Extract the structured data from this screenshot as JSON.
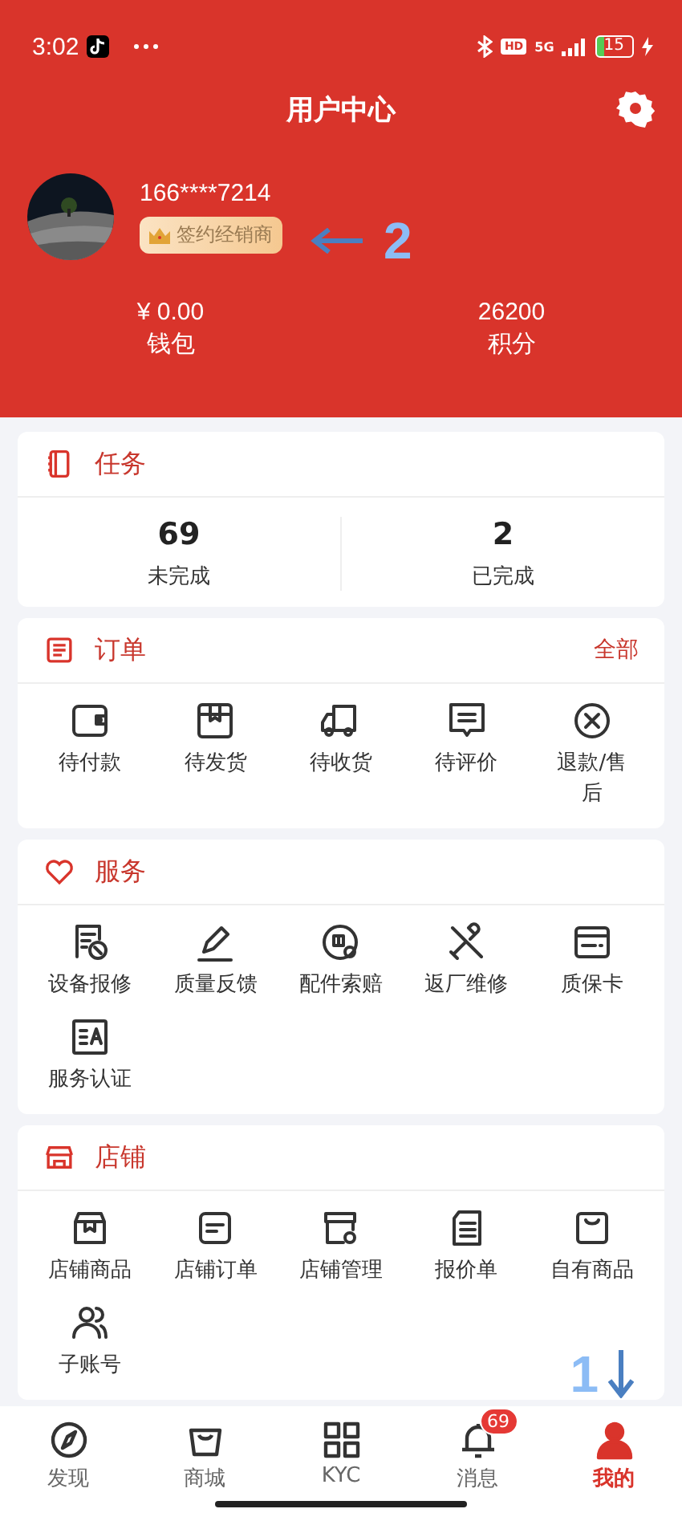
{
  "status_bar": {
    "time": "3:02",
    "network": "5G",
    "hd": "HD",
    "battery": "15"
  },
  "header": {
    "title": "用户中心"
  },
  "profile": {
    "phone": "166****7214",
    "badge": "签约经销商"
  },
  "stats": [
    {
      "value": "¥ 0.00",
      "label": "钱包"
    },
    {
      "value": "26200",
      "label": "积分"
    }
  ],
  "sections": [
    {
      "title": "任务",
      "kind": "counts",
      "counts": [
        {
          "value": "69",
          "label": "未完成"
        },
        {
          "value": "2",
          "label": "已完成"
        }
      ]
    },
    {
      "title": "订单",
      "kind": "grid",
      "link": "全部",
      "items": [
        "待付款",
        "待发货",
        "待收货",
        "待评价",
        "退款/售后"
      ]
    },
    {
      "title": "服务",
      "kind": "grid",
      "items": [
        "设备报修",
        "质量反馈",
        "配件索赔",
        "返厂维修",
        "质保卡",
        "服务认证"
      ]
    },
    {
      "title": "店铺",
      "kind": "grid",
      "items": [
        "店铺商品",
        "店铺订单",
        "店铺管理",
        "报价单",
        "自有商品",
        "子账号"
      ]
    }
  ],
  "tabs": [
    {
      "label": "发现",
      "selected": false
    },
    {
      "label": "商城",
      "selected": false
    },
    {
      "label": "KYC",
      "selected": false
    },
    {
      "label": "消息",
      "selected": false,
      "badge": "69"
    },
    {
      "label": "我的",
      "selected": true
    }
  ],
  "annotations": [
    {
      "label": "2"
    },
    {
      "label": "1"
    }
  ]
}
